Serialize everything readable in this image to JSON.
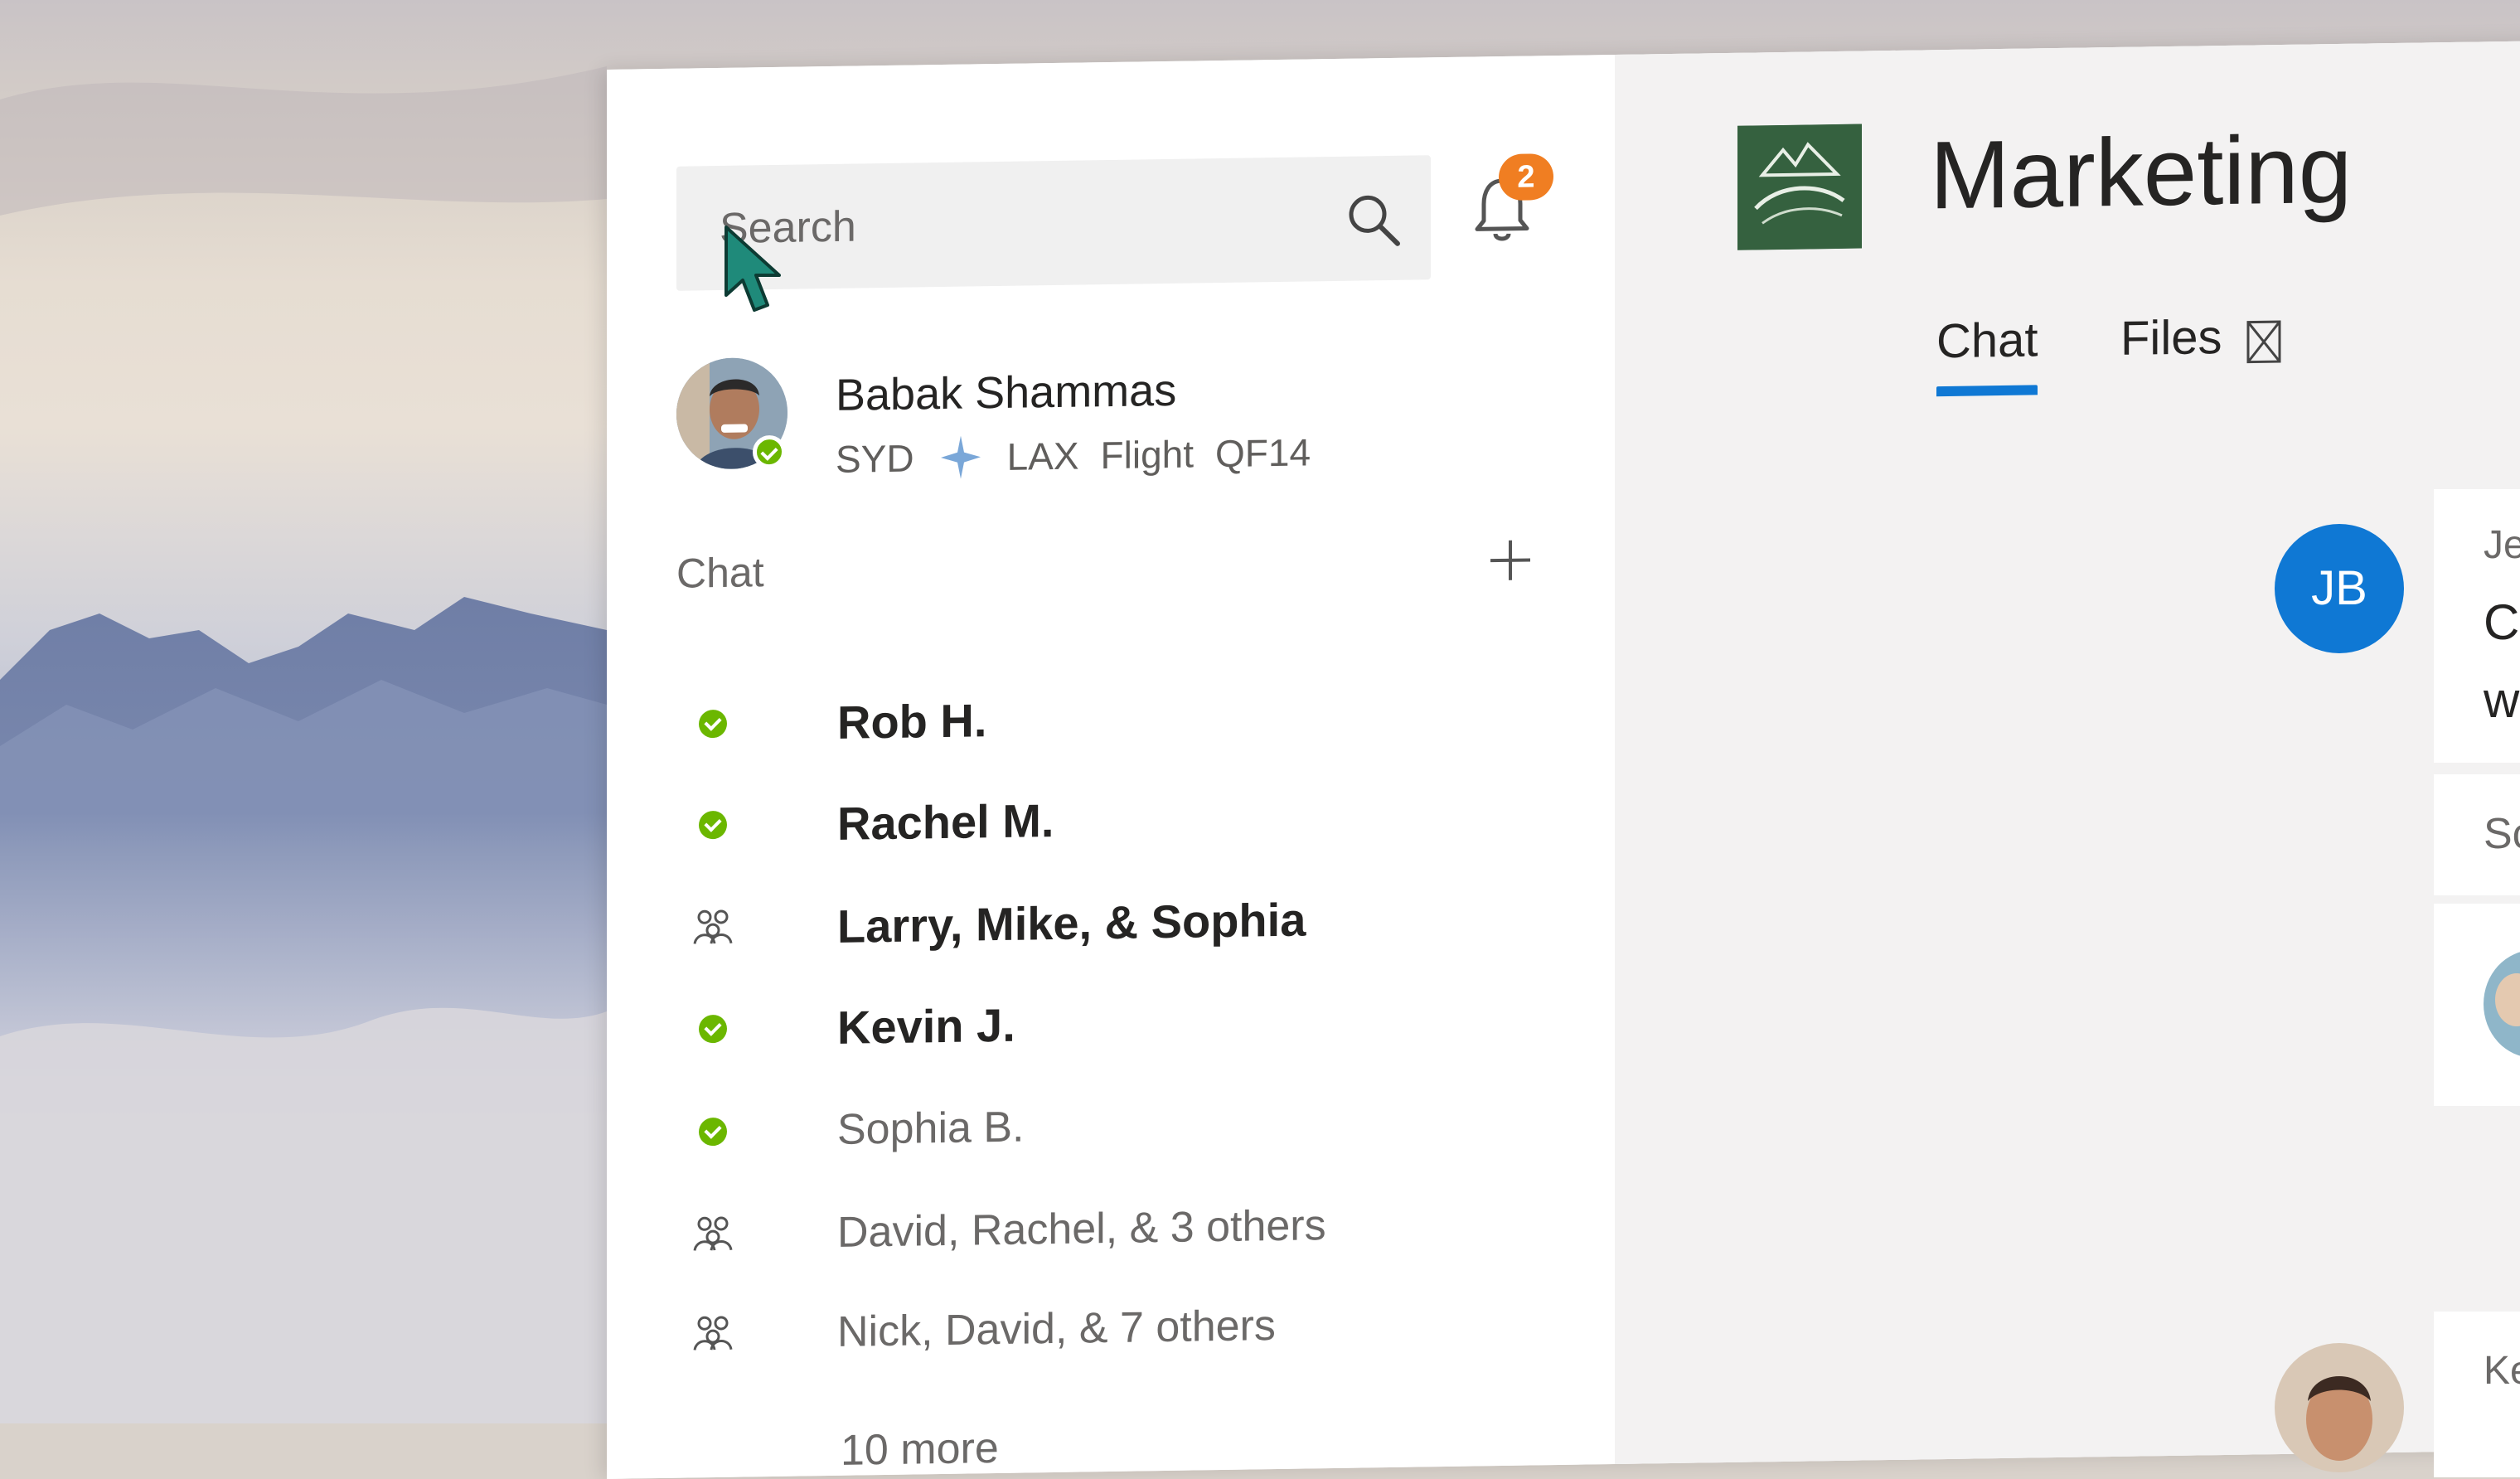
{
  "search": {
    "placeholder": "Search"
  },
  "notifications": {
    "badge_count": "2"
  },
  "profile": {
    "name": "Babak Shammas",
    "status": {
      "from": "SYD",
      "to": "LAX",
      "label": "Flight",
      "flight_number": "QF14"
    }
  },
  "chat_section": {
    "heading": "Chat",
    "items": [
      {
        "label": "Rob H.",
        "icon": "online-icon",
        "unread": true
      },
      {
        "label": "Rachel M.",
        "icon": "online-icon",
        "unread": true
      },
      {
        "label": "Larry, Mike, & Sophia",
        "icon": "group-icon",
        "unread": true
      },
      {
        "label": "Kevin J.",
        "icon": "online-icon",
        "unread": true
      },
      {
        "label": "Sophia B.",
        "icon": "online-icon",
        "unread": false
      },
      {
        "label": "David, Rachel, & 3 others",
        "icon": "group-icon",
        "unread": false
      },
      {
        "label": "Nick, David, & 7 others",
        "icon": "group-icon",
        "unread": false
      }
    ],
    "more_label": "10 more"
  },
  "channel": {
    "title": "Marketing",
    "tabs": [
      {
        "label": "Chat",
        "active": true
      },
      {
        "label": "Files",
        "active": false
      }
    ]
  },
  "messages": {
    "avatar_initials": "JB",
    "partial_texts": [
      "Je",
      "Ca",
      "w",
      "Sc",
      "Ke"
    ]
  },
  "colors": {
    "accent": "#0f78d4",
    "presence_online": "#6bb700",
    "badge": "#f07e22"
  }
}
